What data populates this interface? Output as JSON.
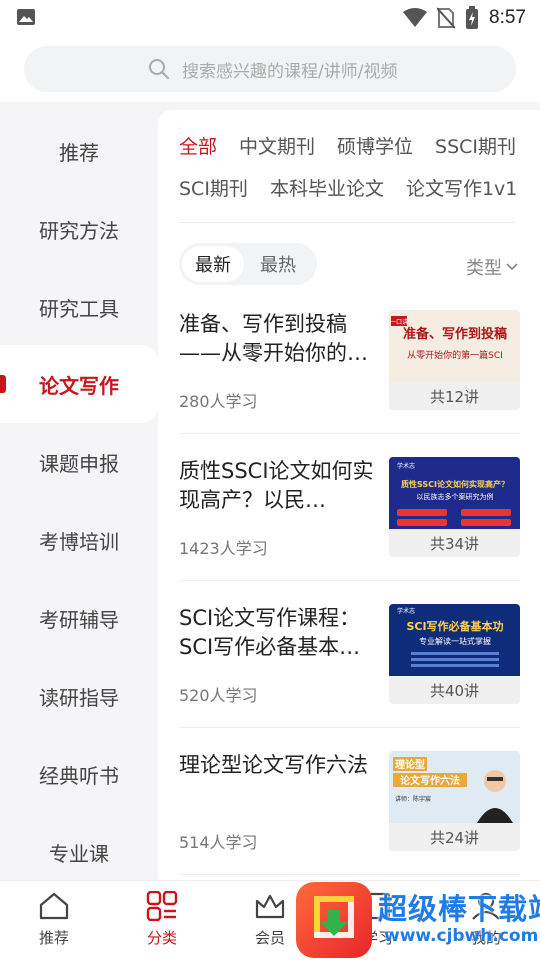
{
  "status_bar": {
    "time": "8:57"
  },
  "search": {
    "placeholder": "搜索感兴趣的课程/讲师/视频"
  },
  "sidebar": {
    "items": [
      {
        "label": "推荐"
      },
      {
        "label": "研究方法"
      },
      {
        "label": "研究工具"
      },
      {
        "label": "论文写作",
        "active": true
      },
      {
        "label": "课题申报"
      },
      {
        "label": "考博培训"
      },
      {
        "label": "考研辅导"
      },
      {
        "label": "读研指导"
      },
      {
        "label": "经典听书"
      },
      {
        "label": "专业课"
      }
    ]
  },
  "filters": {
    "row1": [
      "全部",
      "中文期刊",
      "硕博学位",
      "SSCI期刊"
    ],
    "row2": [
      "SCI期刊",
      "本科毕业论文",
      "论文写作1v1"
    ],
    "selected": "全部"
  },
  "sort": {
    "newest": "最新",
    "hottest": "最热",
    "selected": "最新"
  },
  "type_filter": {
    "label": "类型"
  },
  "courses": [
    {
      "title": "准备、写作到投稿——从零开始你的…",
      "learners": "280人学习",
      "lessons": "共12讲",
      "thumb_lines": [
        "准备、写作到投稿",
        "从零开始你的第一篇SCI"
      ],
      "thumb_tag": "一口讲"
    },
    {
      "title": "质性SSCI论文如何实现高产？以民…",
      "learners": "1423人学习",
      "lessons": "共34讲",
      "thumb_lines": [
        "质性SSCI论文如何实现高产？",
        "以民族志多个案研究为例"
      ],
      "thumb_tag": "学术志"
    },
    {
      "title": "SCI论文写作课程：SCI写作必备基本…",
      "learners": "520人学习",
      "lessons": "共40讲",
      "thumb_lines": [
        "SCI写作必备基本功",
        "专业解读一站式掌握"
      ],
      "thumb_tag": "学术志"
    },
    {
      "title": "理论型论文写作六法",
      "learners": "514人学习",
      "lessons": "共24讲",
      "thumb_lines": [
        "理论型",
        "论文写作六法"
      ],
      "thumb_tag": "讲师：陈宇宸"
    }
  ],
  "tabbar": {
    "items": [
      {
        "label": "推荐"
      },
      {
        "label": "分类",
        "active": true
      },
      {
        "label": "会员"
      },
      {
        "label": "学习"
      },
      {
        "label": "我的"
      }
    ]
  },
  "watermark": {
    "title": "超级棒下载站",
    "url": "www.cjbwh.com"
  },
  "colors": {
    "accent": "#c8161d",
    "background": "#f5f5f7",
    "watermark": "#1f7be8"
  }
}
